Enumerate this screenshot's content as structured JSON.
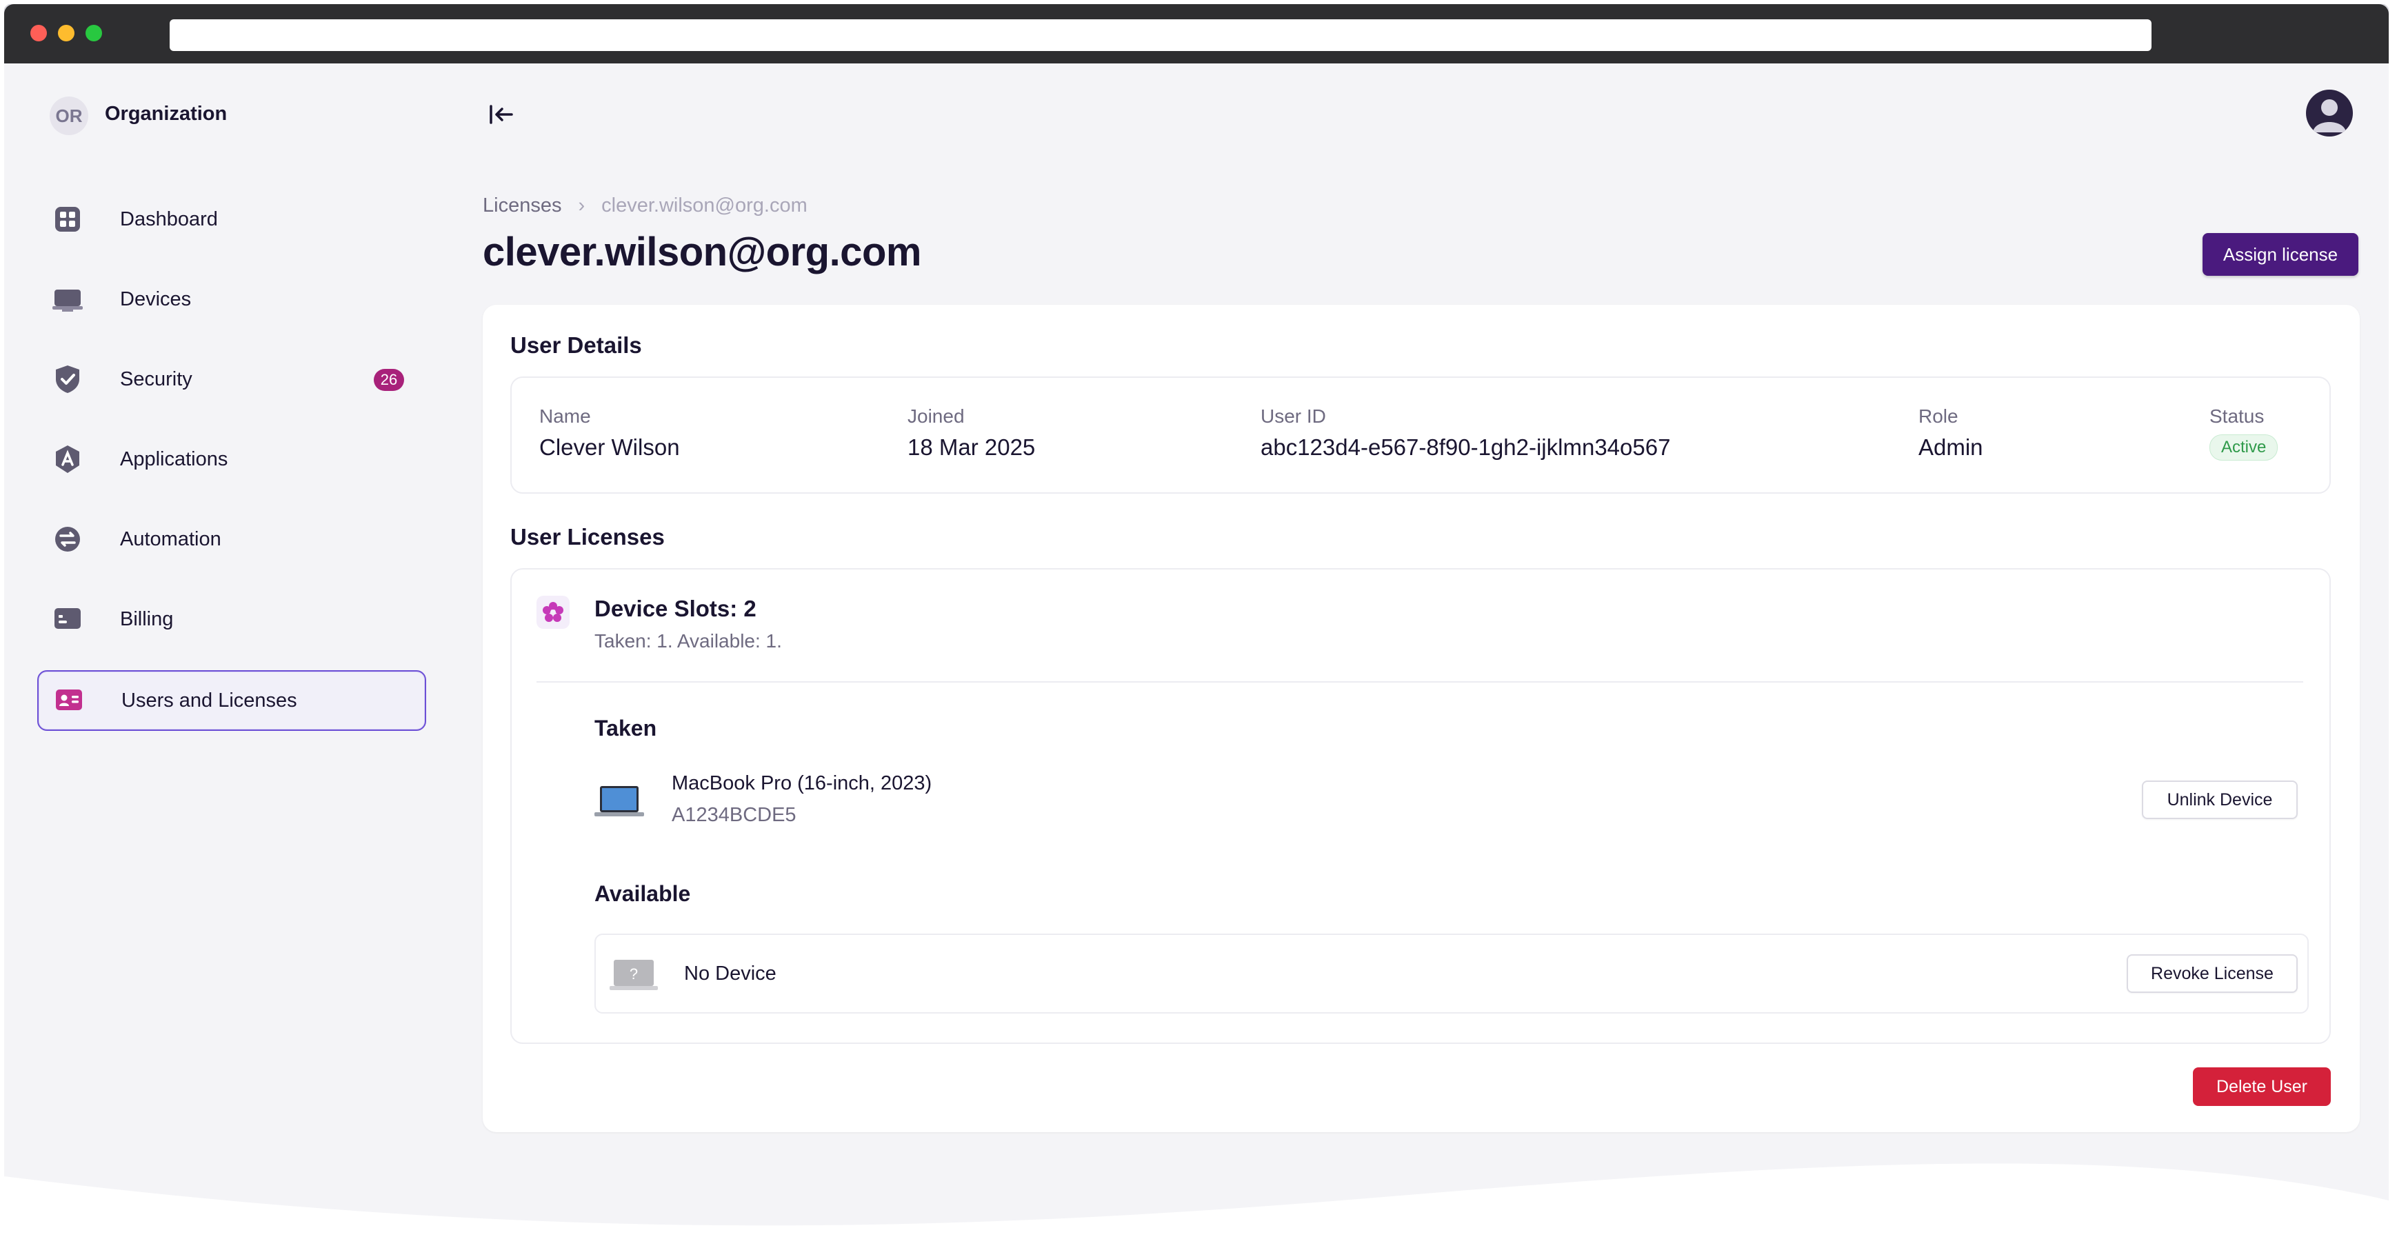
{
  "sidebar": {
    "org_initials": "OR",
    "org_name": "Organization",
    "items": [
      {
        "label": "Dashboard",
        "icon": "dashboard-icon"
      },
      {
        "label": "Devices",
        "icon": "devices-icon"
      },
      {
        "label": "Security",
        "icon": "shield-icon",
        "badge": "26"
      },
      {
        "label": "Applications",
        "icon": "applications-icon"
      },
      {
        "label": "Automation",
        "icon": "automation-icon"
      },
      {
        "label": "Billing",
        "icon": "billing-icon"
      },
      {
        "label": "Users and Licenses",
        "icon": "users-licenses-icon",
        "active": true
      }
    ]
  },
  "breadcrumb": {
    "root": "Licenses",
    "separator": "›",
    "current": "clever.wilson@org.com"
  },
  "header": {
    "title": "clever.wilson@org.com",
    "assign_label": "Assign license"
  },
  "user_details": {
    "title": "User Details",
    "fields": {
      "name_label": "Name",
      "name_value": "Clever Wilson",
      "joined_label": "Joined",
      "joined_value": "18 Mar 2025",
      "userid_label": "User ID",
      "userid_value": "abc123d4-e567-8f90-1gh2-ijklmn34o567",
      "role_label": "Role",
      "role_value": "Admin",
      "status_label": "Status",
      "status_value": "Active"
    }
  },
  "user_licenses": {
    "title": "User Licenses",
    "slots_title": "Device Slots: 2",
    "slots_sub": "Taken: 1. Available: 1.",
    "taken_title": "Taken",
    "taken_device_name": "MacBook Pro (16-inch, 2023)",
    "taken_device_serial": "A1234BCDE5",
    "unlink_label": "Unlink Device",
    "available_title": "Available",
    "no_device_label": "No Device",
    "revoke_label": "Revoke License"
  },
  "delete_label": "Delete User",
  "colors": {
    "accent": "#4a1a7e",
    "badge": "#a8217a",
    "danger": "#d4213a",
    "success": "#2f9a4a"
  }
}
